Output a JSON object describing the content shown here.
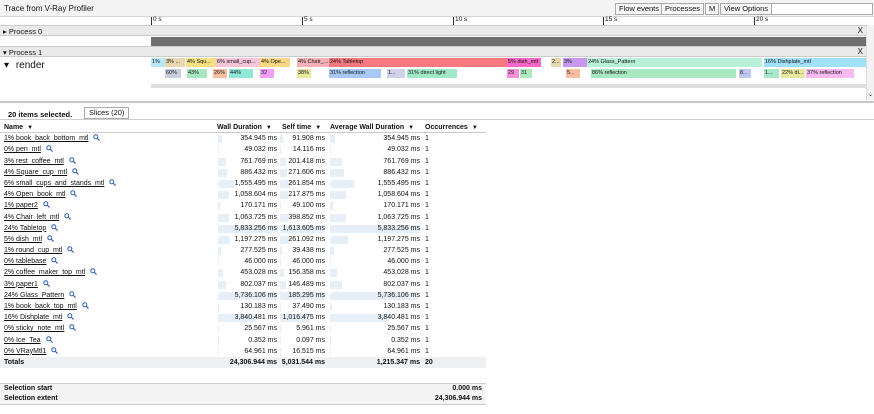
{
  "title": "Trace from V-Ray Profiler",
  "toolbar": {
    "flow_events": "Flow events",
    "processes": "Processes",
    "m": "M",
    "view_options": "View Options"
  },
  "ruler": [
    "0 s",
    "5 s",
    "10 s",
    "15 s",
    "20 s"
  ],
  "process0": {
    "label": "Process 0",
    "close": "X"
  },
  "process1": {
    "label": "Process 1",
    "close": "X"
  },
  "thread": "render",
  "slices_top": [
    {
      "label": "1%",
      "color": "#b8e8f8"
    },
    {
      "label": "3% ...",
      "color": "#e8d8b0"
    },
    {
      "label": "4% Squ...",
      "color": "#f4e080"
    },
    {
      "label": "6% small_cup...",
      "color": "#f8c4d8"
    },
    {
      "label": "4% Ope...",
      "color": "#f8d880"
    },
    {
      "label": "4% Chair_...",
      "color": "#f8b0b8"
    },
    {
      "label": "24% Tabletop",
      "color": "#f87880"
    },
    {
      "label": "5% dish_mtl",
      "color": "#f868c8"
    },
    {
      "label": "2...",
      "color": "#e8d8b0"
    },
    {
      "label": "3%",
      "color": "#c898f0"
    },
    {
      "label": "24% Glass_Pattern",
      "color": "#b8f0d8"
    },
    {
      "label": "16% Dishplate_mtl",
      "color": "#a0e0f8"
    }
  ],
  "slices_bottom": [
    {
      "label": "60%",
      "color": "#c8d0e0"
    },
    {
      "label": "43%",
      "color": "#a8e8c0"
    },
    {
      "label": "26%",
      "color": "#f8c0a0"
    },
    {
      "label": "44%",
      "color": "#90e8d8"
    },
    {
      "label": "32",
      "color": "#f0a0f8"
    },
    {
      "label": "38%",
      "color": "#e8e8a0"
    },
    {
      "label": "31% reflection",
      "color": "#a8c8f8"
    },
    {
      "label": "1...",
      "color": "#d0d0e8"
    },
    {
      "label": "31% direct light",
      "color": "#a0e8c8"
    },
    {
      "label": "29",
      "color": "#f890d8"
    },
    {
      "label": "31",
      "color": "#b0e8c0"
    },
    {
      "label": "5...",
      "color": "#f8c0a0"
    },
    {
      "label": "86% reflection",
      "color": "#a8e8c0"
    },
    {
      "label": "8...",
      "color": "#c0c8f0"
    },
    {
      "label": "1...",
      "color": "#a8e8c8"
    },
    {
      "label": "22% di...",
      "color": "#e8e8a0"
    },
    {
      "label": "37% reflection",
      "color": "#f8b8f0"
    }
  ],
  "selection_summary": "20 items selected.",
  "tab": "Slices (20)",
  "columns": {
    "name": "Name",
    "wall": "Wall Duration",
    "self": "Self time",
    "avg": "Average Wall Duration",
    "occ": "Occurrences"
  },
  "rows": [
    {
      "name": "1% book_back_bottom_mtl",
      "wall": "354.945 ms",
      "self": "91.908 ms",
      "avg": "354.945 ms",
      "occ": "1",
      "wall_frac": 0.061
    },
    {
      "name": "0% pen_mtl",
      "wall": "49.032 ms",
      "self": "14.116 ms",
      "avg": "49.032 ms",
      "occ": "1",
      "wall_frac": 0.008
    },
    {
      "name": "3% rest_coffee_mtl",
      "wall": "761.769 ms",
      "self": "201.418 ms",
      "avg": "761.769 ms",
      "occ": "1",
      "wall_frac": 0.131
    },
    {
      "name": "4% Square_cup_mtl",
      "wall": "886.432 ms",
      "self": "271.606 ms",
      "avg": "886.432 ms",
      "occ": "1",
      "wall_frac": 0.152
    },
    {
      "name": "6% small_cups_and_stands_mtl",
      "wall": "1,555.495 ms",
      "self": "261.854 ms",
      "avg": "1,555.495 ms",
      "occ": "1",
      "wall_frac": 0.267
    },
    {
      "name": "4% Open_book_mtl",
      "wall": "1,058.604 ms",
      "self": "217.875 ms",
      "avg": "1,058.604 ms",
      "occ": "1",
      "wall_frac": 0.181
    },
    {
      "name": "1% paper2",
      "wall": "170.171 ms",
      "self": "49.100 ms",
      "avg": "170.171 ms",
      "occ": "1",
      "wall_frac": 0.029
    },
    {
      "name": "4% Chair_left_mtl",
      "wall": "1,063.725 ms",
      "self": "398.852 ms",
      "avg": "1,063.725 ms",
      "occ": "1",
      "wall_frac": 0.182
    },
    {
      "name": "24% Tabletop",
      "wall": "5,833.256 ms",
      "self": "1,613.605 ms",
      "avg": "5,833.256 ms",
      "occ": "1",
      "wall_frac": 1.0
    },
    {
      "name": "5% dish_mtl",
      "wall": "1,197.275 ms",
      "self": "261.092 ms",
      "avg": "1,197.275 ms",
      "occ": "1",
      "wall_frac": 0.205
    },
    {
      "name": "1% round_cup_mtl",
      "wall": "277.525 ms",
      "self": "39.438 ms",
      "avg": "277.525 ms",
      "occ": "1",
      "wall_frac": 0.048
    },
    {
      "name": "0% tablebase",
      "wall": "46.000 ms",
      "self": "46.000 ms",
      "avg": "46.000 ms",
      "occ": "1",
      "wall_frac": 0.008
    },
    {
      "name": "2% coffee_maker_top_mtl",
      "wall": "453.028 ms",
      "self": "156.358 ms",
      "avg": "453.028 ms",
      "occ": "1",
      "wall_frac": 0.078
    },
    {
      "name": "3% paper1",
      "wall": "802.037 ms",
      "self": "146.489 ms",
      "avg": "802.037 ms",
      "occ": "1",
      "wall_frac": 0.137
    },
    {
      "name": "24% Glass_Pattern",
      "wall": "5,736.106 ms",
      "self": "185.295 ms",
      "avg": "5,736.106 ms",
      "occ": "1",
      "wall_frac": 0.983
    },
    {
      "name": "1% book_back_top_mtl",
      "wall": "130.183 ms",
      "self": "37.490 ms",
      "avg": "130.183 ms",
      "occ": "1",
      "wall_frac": 0.022
    },
    {
      "name": "16% Dishplate_mtl",
      "wall": "3,840.481 ms",
      "self": "1,016.475 ms",
      "avg": "3,840.481 ms",
      "occ": "1",
      "wall_frac": 0.658
    },
    {
      "name": "0% sticky_note_mtl",
      "wall": "25.567 ms",
      "self": "5.961 ms",
      "avg": "25.567 ms",
      "occ": "1",
      "wall_frac": 0.004
    },
    {
      "name": "0% Ice_Tea",
      "wall": "0.352 ms",
      "self": "0.097 ms",
      "avg": "0.352 ms",
      "occ": "1",
      "wall_frac": 0.0
    },
    {
      "name": "0% VRayMtl1",
      "wall": "64.961 ms",
      "self": "16.515 ms",
      "avg": "64.961 ms",
      "occ": "1",
      "wall_frac": 0.011
    }
  ],
  "totals": {
    "label": "Totals",
    "wall": "24,306.944 ms",
    "self": "5,031.544 ms",
    "avg": "1,215.347 ms",
    "occ": "20"
  },
  "selection_start": {
    "label": "Selection start",
    "value": "0.000 ms"
  },
  "selection_extent": {
    "label": "Selection extent",
    "value": "24,306.944 ms"
  }
}
